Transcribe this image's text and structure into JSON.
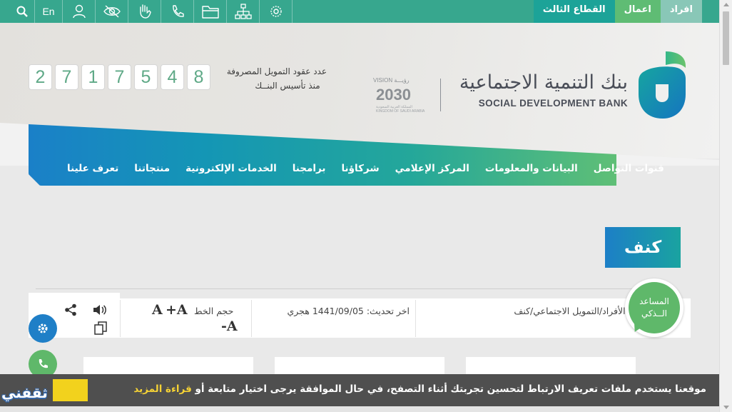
{
  "topbar": {
    "tabs": [
      {
        "label": "افراد"
      },
      {
        "label": "اعمال"
      },
      {
        "label": "القطاع الثالث"
      }
    ],
    "lang_label": "En"
  },
  "header": {
    "bank_name_ar": "بنك التنمية الاجتماعية",
    "bank_name_en": "SOCIAL DEVELOPMENT BANK",
    "vision_label": "VISION رؤيـــة",
    "vision_year": "2030",
    "vision_sub": "المملكة العربية السعودية KINGDOM OF SAUDI ARABIA",
    "counter_label_line1": "عدد عقود التمويل المصروفة",
    "counter_label_line2": "منذ تأسيس البنــك",
    "counter_digits": [
      "2",
      "7",
      "1",
      "7",
      "5",
      "4",
      "8"
    ]
  },
  "nav": {
    "items": [
      {
        "label": "تعرف علينا"
      },
      {
        "label": "منتجاتنا"
      },
      {
        "label": "الخدمات الإلكترونية"
      },
      {
        "label": "برامجنا"
      },
      {
        "label": "شركاؤنا"
      },
      {
        "label": "المركز الإعلامي"
      },
      {
        "label": "البيانات والمعلومات"
      },
      {
        "label": "قنوات التواصل"
      }
    ]
  },
  "page": {
    "title": "كنف",
    "breadcrumb": "الرئيسية/تمويل الأفراد/التمويل الاجتماعي/كنف",
    "updated": "اخر تحديث: 1441/09/05 هجري",
    "font_size_label": "حجم الخط",
    "font_plus": "+A",
    "font_base": "A",
    "font_minus": "-A"
  },
  "chatbot": {
    "line1": "المساعد",
    "line2": "الــذكي"
  },
  "cookie": {
    "text": "موقعنا يستخدم ملفات تعريف الارتباط لتحسين تجربتك أثناء التصفح، في حال الموافقة يرجى اختيار متابعة أو ",
    "more_label": "قراءة المزيد"
  },
  "watermark": "ثقفني",
  "colors": {
    "topbar": "#37a78e",
    "accent_blue": "#1a80c8",
    "accent_green": "#5fbf76",
    "cookie_bg": "#4f4f4f",
    "cookie_link": "#f5d235"
  }
}
